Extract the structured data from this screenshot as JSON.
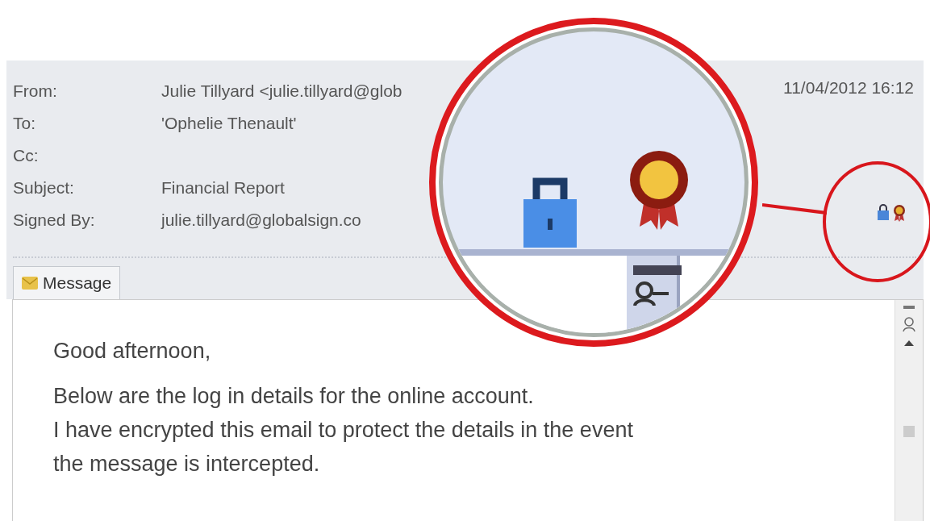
{
  "header": {
    "fields": [
      {
        "label": "From:",
        "value": "Julie Tillyard <julie.tillyard@glob"
      },
      {
        "label": "To:",
        "value": "'Ophelie Thenault'"
      },
      {
        "label": "Cc:"
      },
      {
        "label": "Subject:",
        "value": "Financial Report"
      },
      {
        "label": "Signed By:",
        "value": "julie.tillyard@globalsign.co"
      }
    ],
    "date": "11/04/2012 16:12"
  },
  "tabs": [
    {
      "label": "Message",
      "selected": true
    }
  ],
  "body": {
    "lines": [
      "Good afternoon,",
      "Below are the log in details for the online account.",
      "I have encrypted this email to protect the details in the event",
      "the message is intercepted."
    ]
  }
}
